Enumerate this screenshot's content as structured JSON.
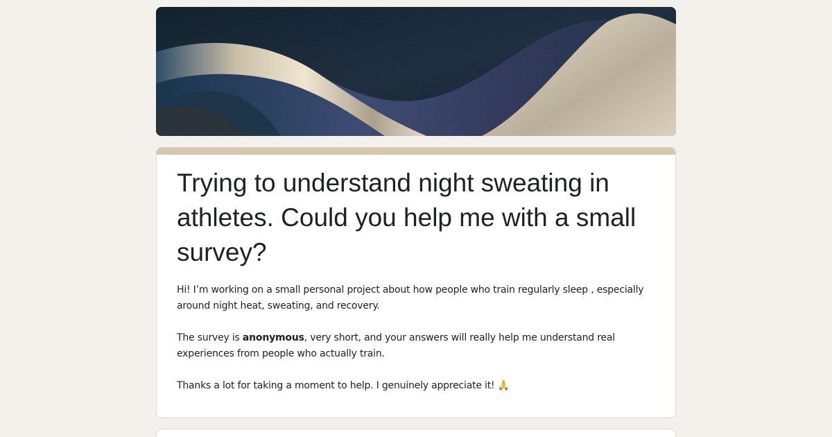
{
  "banner": {
    "image_name": "abstract-wave-header-image"
  },
  "form": {
    "title": "Trying to understand night sweating in athletes. Could you help me with a small survey?",
    "description": {
      "p1": "Hi! I’m working on a small personal project about how people who train regularly sleep , especially around night heat, sweating, and recovery.",
      "p2_before": "The survey is ",
      "p2_bold": "anonymous",
      "p2_after": ", very short, and your answers will really help me understand real experiences from people who actually train.",
      "p3": "Thanks a lot for taking a moment to help. I genuinely appreciate it! 🙏"
    }
  },
  "colors": {
    "page_background": "#f4f1ec",
    "accent": "#d6c8ad",
    "text": "#202124"
  }
}
